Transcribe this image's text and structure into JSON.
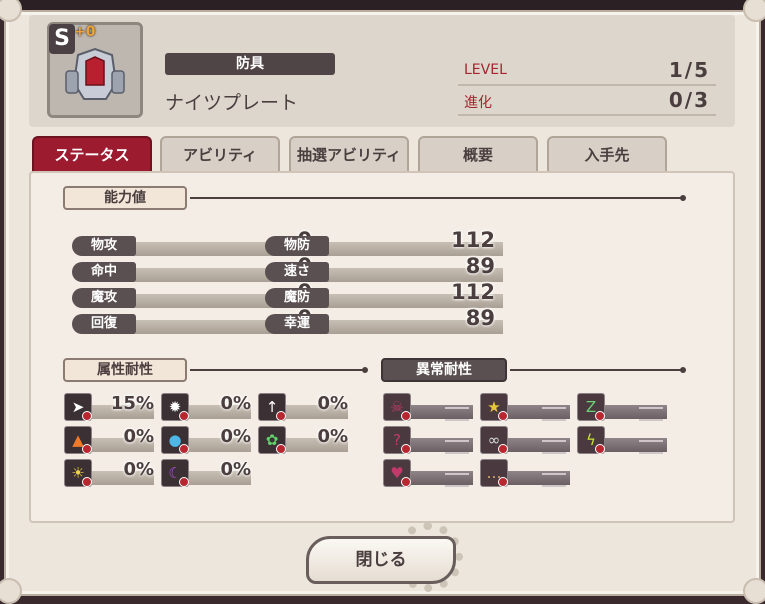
{
  "item": {
    "rank": "S",
    "plus": "+0",
    "category": "防具",
    "name": "ナイツプレート",
    "level_label": "LEVEL",
    "level_value": "1/5",
    "evo_label": "進化",
    "evo_value": "0/3"
  },
  "tabs": [
    "ステータス",
    "アビリティ",
    "抽選アビリティ",
    "概要",
    "入手先"
  ],
  "active_tab": "ステータス",
  "sections": {
    "ability": "能力値",
    "element": "属性耐性",
    "ailment": "異常耐性"
  },
  "stats": {
    "left": [
      {
        "label": "物攻",
        "value": "0"
      },
      {
        "label": "命中",
        "value": "0"
      },
      {
        "label": "魔攻",
        "value": "0"
      },
      {
        "label": "回復",
        "value": "0"
      }
    ],
    "right": [
      {
        "label": "物防",
        "value": "112"
      },
      {
        "label": "速さ",
        "value": "89"
      },
      {
        "label": "魔防",
        "value": "112"
      },
      {
        "label": "幸運",
        "value": "89"
      }
    ]
  },
  "element_res": [
    {
      "icon": "slash-icon",
      "value": "15%"
    },
    {
      "icon": "impact-icon",
      "value": "0%"
    },
    {
      "icon": "pierce-icon",
      "value": "0%"
    },
    {
      "icon": "fire-icon",
      "value": "0%"
    },
    {
      "icon": "water-icon",
      "value": "0%"
    },
    {
      "icon": "wind-icon",
      "value": "0%"
    },
    {
      "icon": "light-icon",
      "value": "0%"
    },
    {
      "icon": "dark-icon",
      "value": "0%"
    }
  ],
  "ailment_res": [
    {
      "icon": "poison-icon"
    },
    {
      "icon": "stun-icon"
    },
    {
      "icon": "sleep-icon"
    },
    {
      "icon": "confusion-icon"
    },
    {
      "icon": "blind-icon"
    },
    {
      "icon": "paralysis-icon"
    },
    {
      "icon": "curse-icon"
    },
    {
      "icon": "silence-icon"
    }
  ],
  "close_button": "閉じる",
  "colors": {
    "accent": "#9c1b2e",
    "dark": "#4a3e3f"
  }
}
